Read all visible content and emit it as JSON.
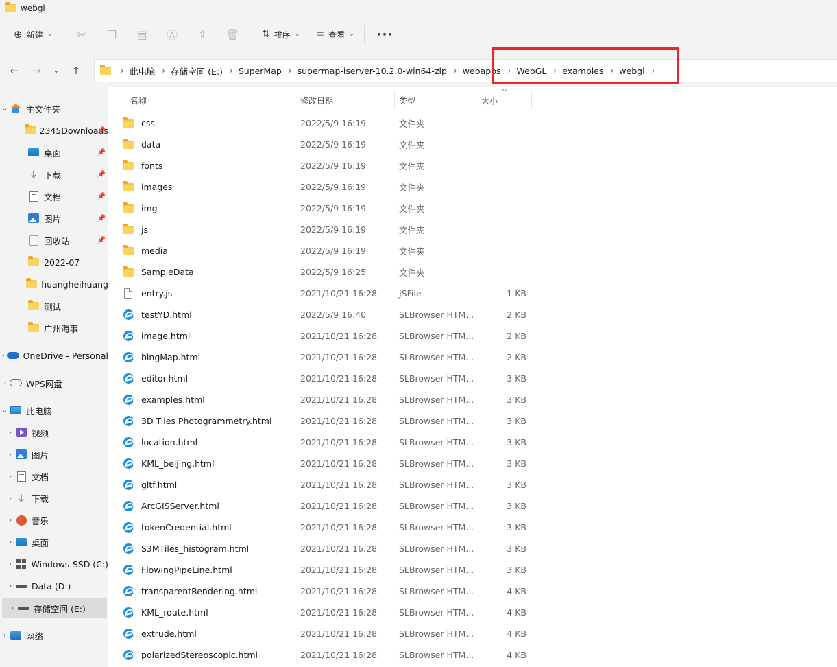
{
  "window": {
    "title": "webgl"
  },
  "toolbar": {
    "new_label": "新建",
    "sort_label": "排序",
    "view_label": "查看",
    "more_label": "···"
  },
  "breadcrumbs": [
    "此电脑",
    "存储空间 (E:)",
    "SuperMap",
    "supermap-iserver-10.2.0-win64-zip",
    "webapps",
    "WebGL",
    "examples",
    "webgl"
  ],
  "sidebar": {
    "items": [
      {
        "label": "主文件夹",
        "icon": "home-icon",
        "expand": "down",
        "pinned": false
      },
      {
        "label": "2345Downloads",
        "icon": "folder-icon",
        "expand": "",
        "pinned": true
      },
      {
        "label": "桌面",
        "icon": "desktop-icon",
        "expand": "",
        "pinned": true
      },
      {
        "label": "下载",
        "icon": "download-icon",
        "expand": "",
        "pinned": true
      },
      {
        "label": "文档",
        "icon": "document-icon",
        "expand": "",
        "pinned": true
      },
      {
        "label": "图片",
        "icon": "picture-icon",
        "expand": "",
        "pinned": true
      },
      {
        "label": "回收站",
        "icon": "recycle-bin-icon",
        "expand": "",
        "pinned": true
      },
      {
        "label": "2022-07",
        "icon": "folder-icon",
        "expand": "",
        "pinned": false
      },
      {
        "label": "huangheihuang",
        "icon": "folder-icon",
        "expand": "",
        "pinned": false
      },
      {
        "label": "测试",
        "icon": "folder-icon",
        "expand": "",
        "pinned": false
      },
      {
        "label": "广州海事",
        "icon": "folder-icon",
        "expand": "",
        "pinned": false
      },
      {
        "label": "OneDrive - Personal",
        "icon": "onedrive-icon",
        "expand": "right",
        "pinned": false
      },
      {
        "label": "WPS网盘",
        "icon": "wps-cloud-icon",
        "expand": "right",
        "pinned": false
      },
      {
        "label": "此电脑",
        "icon": "computer-icon",
        "expand": "down",
        "pinned": false
      },
      {
        "label": "视频",
        "icon": "video-icon",
        "expand": "right",
        "pinned": false
      },
      {
        "label": "图片",
        "icon": "picture-icon",
        "expand": "right",
        "pinned": false
      },
      {
        "label": "文档",
        "icon": "document-icon",
        "expand": "right",
        "pinned": false
      },
      {
        "label": "下载",
        "icon": "download-icon",
        "expand": "right",
        "pinned": false
      },
      {
        "label": "音乐",
        "icon": "music-icon",
        "expand": "right",
        "pinned": false
      },
      {
        "label": "桌面",
        "icon": "desktop-icon",
        "expand": "right",
        "pinned": false
      },
      {
        "label": "Windows-SSD (C:)",
        "icon": "windows-drive-icon",
        "expand": "right",
        "pinned": false
      },
      {
        "label": "Data (D:)",
        "icon": "drive-icon",
        "expand": "right",
        "pinned": false
      },
      {
        "label": "存储空间 (E:)",
        "icon": "drive-icon",
        "expand": "right",
        "pinned": false,
        "selected": true
      },
      {
        "label": "网络",
        "icon": "network-icon",
        "expand": "right",
        "pinned": false
      }
    ]
  },
  "columns": {
    "name": "名称",
    "date": "修改日期",
    "type": "类型",
    "size": "大小"
  },
  "files": [
    {
      "name": "css",
      "date": "2022/5/9 16:19",
      "type": "文件夹",
      "size": "",
      "kind": "folder"
    },
    {
      "name": "data",
      "date": "2022/5/9 16:19",
      "type": "文件夹",
      "size": "",
      "kind": "folder"
    },
    {
      "name": "fonts",
      "date": "2022/5/9 16:19",
      "type": "文件夹",
      "size": "",
      "kind": "folder"
    },
    {
      "name": "images",
      "date": "2022/5/9 16:19",
      "type": "文件夹",
      "size": "",
      "kind": "folder"
    },
    {
      "name": "img",
      "date": "2022/5/9 16:19",
      "type": "文件夹",
      "size": "",
      "kind": "folder"
    },
    {
      "name": "js",
      "date": "2022/5/9 16:19",
      "type": "文件夹",
      "size": "",
      "kind": "folder"
    },
    {
      "name": "media",
      "date": "2022/5/9 16:19",
      "type": "文件夹",
      "size": "",
      "kind": "folder"
    },
    {
      "name": "SampleData",
      "date": "2022/5/9 16:25",
      "type": "文件夹",
      "size": "",
      "kind": "folder"
    },
    {
      "name": "entry.js",
      "date": "2021/10/21 16:28",
      "type": "JSFile",
      "size": "1 KB",
      "kind": "file"
    },
    {
      "name": "testYD.html",
      "date": "2022/5/9 16:40",
      "type": "SLBrowser HTM...",
      "size": "2 KB",
      "kind": "html"
    },
    {
      "name": "image.html",
      "date": "2021/10/21 16:28",
      "type": "SLBrowser HTM...",
      "size": "2 KB",
      "kind": "html"
    },
    {
      "name": "bingMap.html",
      "date": "2021/10/21 16:28",
      "type": "SLBrowser HTM...",
      "size": "2 KB",
      "kind": "html"
    },
    {
      "name": "editor.html",
      "date": "2021/10/21 16:28",
      "type": "SLBrowser HTM...",
      "size": "3 KB",
      "kind": "html"
    },
    {
      "name": "examples.html",
      "date": "2021/10/21 16:28",
      "type": "SLBrowser HTM...",
      "size": "3 KB",
      "kind": "html"
    },
    {
      "name": "3D Tiles Photogrammetry.html",
      "date": "2021/10/21 16:28",
      "type": "SLBrowser HTM...",
      "size": "3 KB",
      "kind": "html"
    },
    {
      "name": "location.html",
      "date": "2021/10/21 16:28",
      "type": "SLBrowser HTM...",
      "size": "3 KB",
      "kind": "html"
    },
    {
      "name": "KML_beijing.html",
      "date": "2021/10/21 16:28",
      "type": "SLBrowser HTM...",
      "size": "3 KB",
      "kind": "html"
    },
    {
      "name": "gltf.html",
      "date": "2021/10/21 16:28",
      "type": "SLBrowser HTM...",
      "size": "3 KB",
      "kind": "html"
    },
    {
      "name": "ArcGISServer.html",
      "date": "2021/10/21 16:28",
      "type": "SLBrowser HTM...",
      "size": "3 KB",
      "kind": "html"
    },
    {
      "name": "tokenCredential.html",
      "date": "2021/10/21 16:28",
      "type": "SLBrowser HTM...",
      "size": "3 KB",
      "kind": "html"
    },
    {
      "name": "S3MTiles_histogram.html",
      "date": "2021/10/21 16:28",
      "type": "SLBrowser HTM...",
      "size": "3 KB",
      "kind": "html"
    },
    {
      "name": "FlowingPipeLine.html",
      "date": "2021/10/21 16:28",
      "type": "SLBrowser HTM...",
      "size": "3 KB",
      "kind": "html"
    },
    {
      "name": "transparentRendering.html",
      "date": "2021/10/21 16:28",
      "type": "SLBrowser HTM...",
      "size": "4 KB",
      "kind": "html"
    },
    {
      "name": "KML_route.html",
      "date": "2021/10/21 16:28",
      "type": "SLBrowser HTM...",
      "size": "4 KB",
      "kind": "html"
    },
    {
      "name": "extrude.html",
      "date": "2021/10/21 16:28",
      "type": "SLBrowser HTM...",
      "size": "4 KB",
      "kind": "html"
    },
    {
      "name": "polarizedStereoscopic.html",
      "date": "2021/10/21 16:28",
      "type": "SLBrowser HTM...",
      "size": "4 KB",
      "kind": "html"
    }
  ],
  "colors": {
    "highlight": "#e8262b",
    "folder": "#f6c543",
    "html_icon": "#1a8fe0"
  }
}
